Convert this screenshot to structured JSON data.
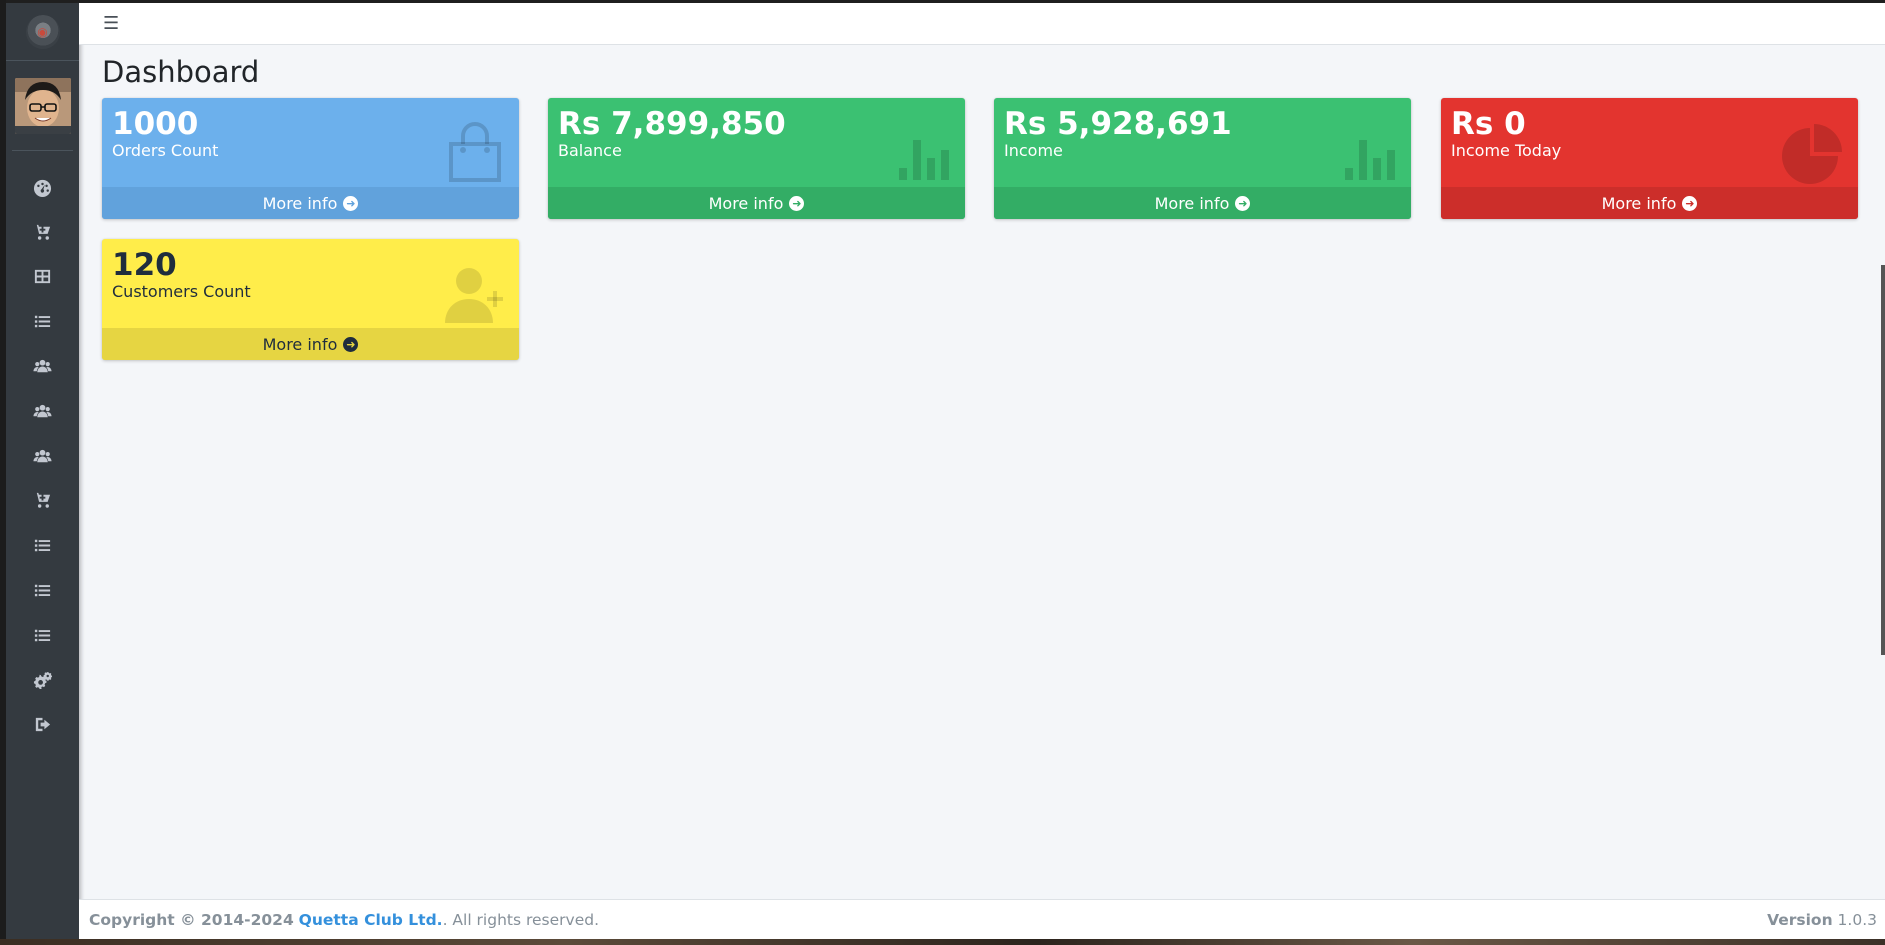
{
  "navbar": {
    "menu_icon": "hamburger-icon"
  },
  "page": {
    "title": "Dashboard"
  },
  "sidebar": {
    "items": [
      {
        "icon": "tachometer-icon"
      },
      {
        "icon": "cart-plus-icon"
      },
      {
        "icon": "table-icon"
      },
      {
        "icon": "list-icon"
      },
      {
        "icon": "users-icon"
      },
      {
        "icon": "users-icon"
      },
      {
        "icon": "users-icon"
      },
      {
        "icon": "cart-plus-icon"
      },
      {
        "icon": "list-icon"
      },
      {
        "icon": "list-icon"
      },
      {
        "icon": "list-icon"
      },
      {
        "icon": "cogs-icon"
      },
      {
        "icon": "sign-out-icon"
      }
    ]
  },
  "boxes": [
    {
      "value": "1000",
      "label": "Orders Count",
      "more": "More info",
      "color": "#6cb0ec",
      "icon": "shopping-bag-icon"
    },
    {
      "value": "Rs 7,899,850",
      "label": "Balance",
      "more": "More info",
      "color": "#3bc172",
      "icon": "bar-chart-icon"
    },
    {
      "value": "Rs 5,928,691",
      "label": "Income",
      "more": "More info",
      "color": "#3bc172",
      "icon": "bar-chart-icon"
    },
    {
      "value": "Rs 0",
      "label": "Income Today",
      "more": "More info",
      "color": "#e3342f",
      "icon": "pie-chart-icon"
    },
    {
      "value": "120",
      "label": "Customers Count",
      "more": "More info",
      "color": "#ffed4a",
      "icon": "user-plus-icon"
    }
  ],
  "footer": {
    "copyright_prefix": "Copyright © 2014-2024",
    "company": "Quetta Club Ltd.",
    "suffix": ". All rights reserved.",
    "version_label": "Version",
    "version_number": "1.0.3"
  }
}
